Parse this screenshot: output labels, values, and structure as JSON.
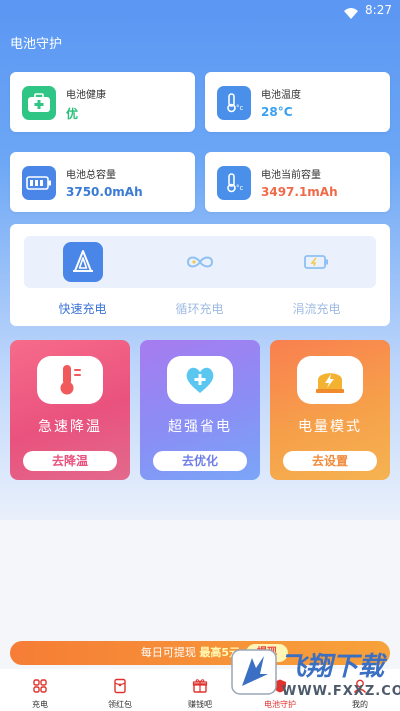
{
  "status": {
    "time": "8:27"
  },
  "app": {
    "title": "电池守护"
  },
  "cards": {
    "health": {
      "label": "电池健康",
      "value": "优",
      "color": "#27c07a"
    },
    "temperature": {
      "label": "电池温度",
      "value": "28°C",
      "color": "#3aa0f0"
    },
    "total_capacity": {
      "label": "电池总容量",
      "value": "3750.0mAh",
      "color": "#3a7bd5"
    },
    "current_capacity": {
      "label": "电池当前容量",
      "value": "3497.1mAh",
      "color": "#f06a4a"
    }
  },
  "modes": [
    {
      "label": "快速充电",
      "active": true,
      "icon": "rocket-icon"
    },
    {
      "label": "循环充电",
      "active": false,
      "icon": "infinity-icon"
    },
    {
      "label": "涓流充电",
      "active": false,
      "icon": "battery-trickle-icon"
    }
  ],
  "features": [
    {
      "title": "急速降温",
      "button": "去降温",
      "icon": "thermometer-icon"
    },
    {
      "title": "超强省电",
      "button": "去优化",
      "icon": "heart-plus-icon"
    },
    {
      "title": "电量模式",
      "button": "去设置",
      "icon": "bolt-icon"
    }
  ],
  "banner": {
    "text": "每日可提现",
    "highlight": "最高5元",
    "button": "提现"
  },
  "tabs": [
    {
      "label": "充电",
      "icon": "grid-icon"
    },
    {
      "label": "领红包",
      "icon": "red-packet-icon"
    },
    {
      "label": "赚钱吧",
      "icon": "gift-icon"
    },
    {
      "label": "电池守护",
      "icon": "battery-guard-icon",
      "active": true
    },
    {
      "label": "我的",
      "icon": "user-icon"
    }
  ],
  "watermark": {
    "logo": "飞翔下载",
    "url": "WWW.FXXZ.COM"
  },
  "colors": {
    "primary": "#4a86e8",
    "active_tab": "#e0322e"
  }
}
